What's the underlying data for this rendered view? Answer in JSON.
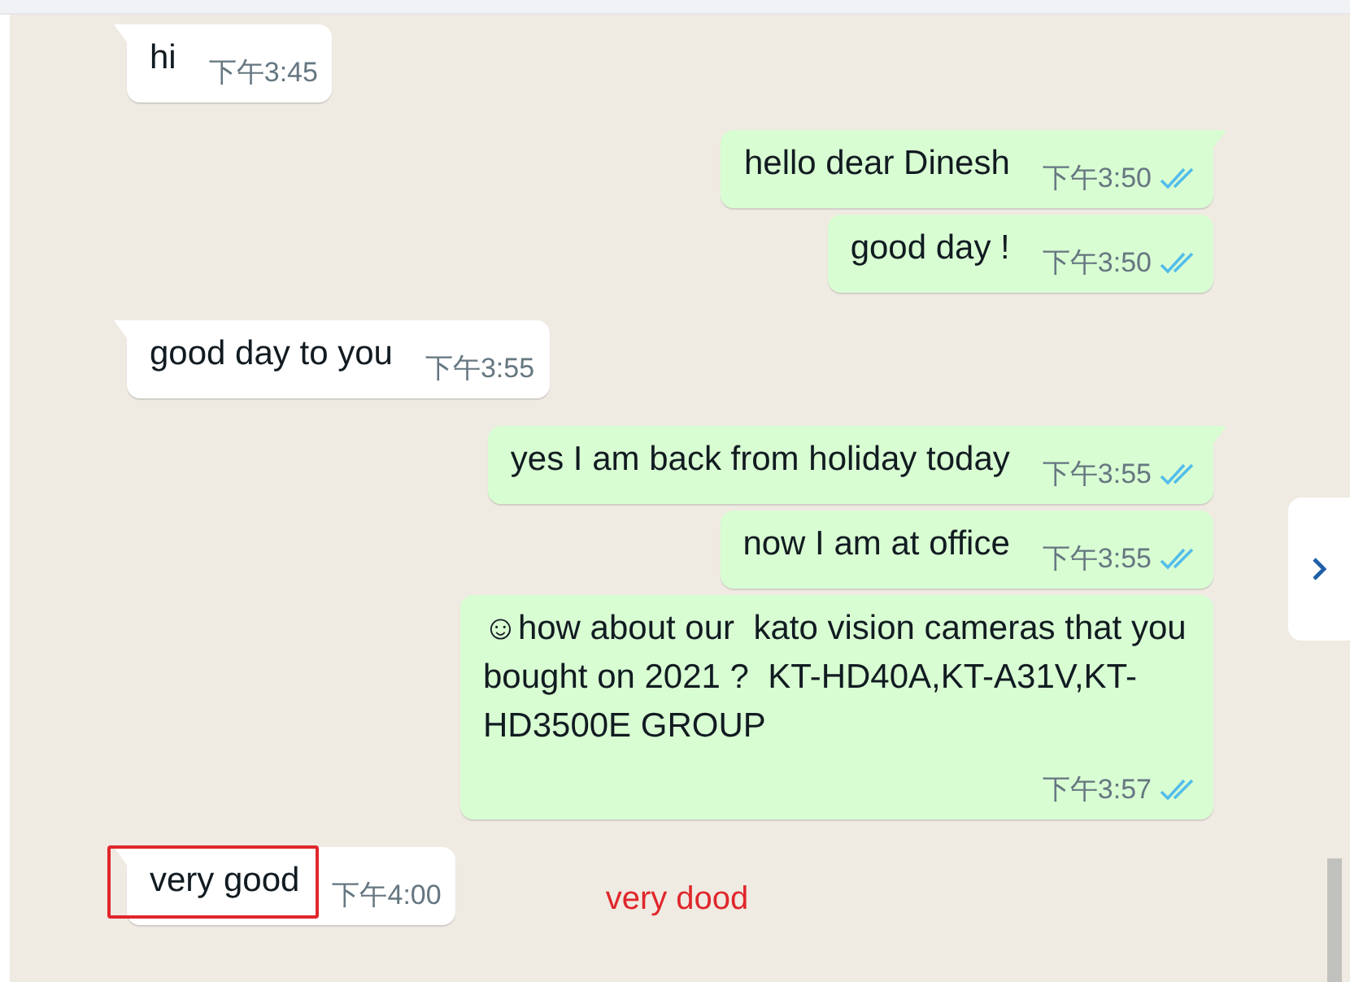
{
  "messages": [
    {
      "kind": "incoming",
      "tail": true,
      "text": "hi",
      "time": "下午3:45"
    },
    {
      "kind": "outgoing",
      "tail": true,
      "text": "hello dear Dinesh",
      "time": "下午3:50",
      "read": true
    },
    {
      "kind": "outgoing",
      "tail": false,
      "text": "good day !",
      "time": "下午3:50",
      "read": true
    },
    {
      "kind": "incoming",
      "tail": true,
      "text": "good day to you",
      "time": "下午3:55"
    },
    {
      "kind": "outgoing",
      "tail": true,
      "text": "yes I am back from holiday today",
      "time": "下午3:55",
      "read": true
    },
    {
      "kind": "outgoing",
      "tail": false,
      "text": "now I am at office",
      "time": "下午3:55",
      "read": true
    },
    {
      "kind": "outgoing",
      "tail": false,
      "text": "☺how about our  kato vision cameras that you bought on 2021 ?  KT-HD40A,KT-A31V,KT-HD3500E GROUP",
      "time": "下午3:57",
      "read": true
    },
    {
      "kind": "incoming",
      "tail": true,
      "text": "very good",
      "time": "下午4:00",
      "highlighted": true,
      "note": "very dood"
    }
  ]
}
